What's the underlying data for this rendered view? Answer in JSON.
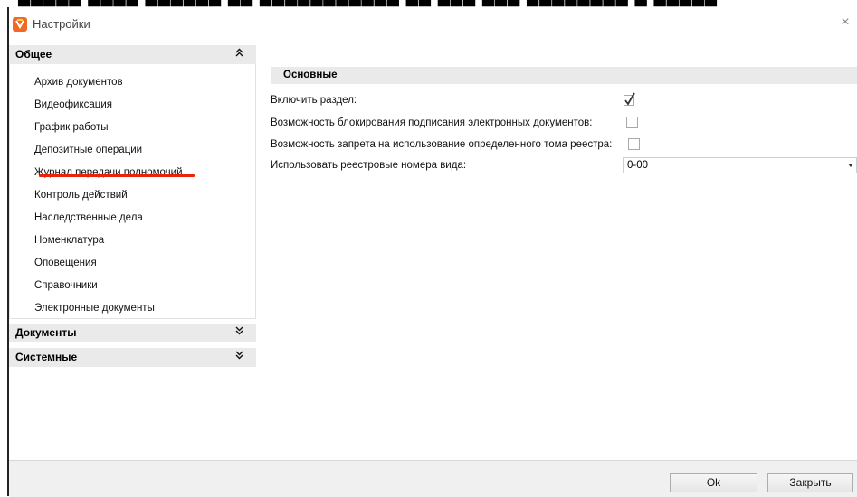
{
  "window": {
    "title": "Настройки",
    "close_glyph": "×"
  },
  "accordion": {
    "groups": [
      {
        "title": "Общее",
        "expanded": true,
        "chevron": "⌃",
        "items": [
          "Архив документов",
          "Видеофиксация",
          "График работы",
          "Депозитные операции",
          "Журнал передачи полномочий",
          "Контроль действий",
          "Наследственные дела",
          "Номенклатура",
          "Оповещения",
          "Справочники",
          "Электронные документы"
        ]
      },
      {
        "title": "Документы",
        "expanded": false
      },
      {
        "title": "Системные",
        "expanded": false
      }
    ],
    "highlighted_item": "Журнал передачи полномочий",
    "highlight_color": "#e8240d"
  },
  "settings": {
    "section_title": "Основные",
    "fields": [
      {
        "label": "Включить раздел:",
        "type": "checkbox",
        "checked": true
      },
      {
        "label": "Возможность блокирования подписания электронных документов:",
        "type": "checkbox",
        "checked": false
      },
      {
        "label": "Возможность запрета на использование определенного тома реестра:",
        "type": "checkbox",
        "checked": false
      },
      {
        "label": "Использовать реестровые номера вида:",
        "type": "select",
        "value": "0-00"
      }
    ]
  },
  "footer": {
    "ok_label": "Ok",
    "close_label": "Закрыть"
  },
  "colors": {
    "app_icon": "#f06a25",
    "header_bg": "#eaeaea"
  }
}
